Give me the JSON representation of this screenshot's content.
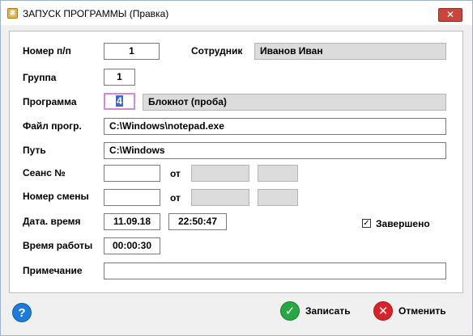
{
  "window": {
    "title": "ЗАПУСК ПРОГРАММЫ (Правка)",
    "icon": "app-icon",
    "close_label": "✕"
  },
  "form": {
    "labels": {
      "number": "Номер п/п",
      "employee": "Сотрудник",
      "group": "Группа",
      "program": "Программа",
      "program_file": "Файл прогр.",
      "path": "Путь",
      "session": "Сеанс №",
      "shift": "Номер смены",
      "datetime": "Дата. время",
      "work_time": "Время работы",
      "note": "Примечание",
      "from1": "от",
      "from2": "от"
    },
    "values": {
      "number": "1",
      "employee": "Иванов Иван",
      "group": "1",
      "program_id": "4",
      "program_name": "Блокнот (проба)",
      "program_file": "C:\\Windows\\notepad.exe",
      "path": "C:\\Windows",
      "session": "",
      "session_from_a": "",
      "session_from_b": "",
      "shift": "",
      "shift_from_a": "",
      "shift_from_b": "",
      "date": "11.09.18",
      "time": "22:50:47",
      "work_time": "00:00:30",
      "note": ""
    },
    "completed": {
      "label": "Завершено",
      "checked": true,
      "mark": "✓"
    }
  },
  "buttons": {
    "help": "?",
    "save": "Записать",
    "cancel": "Отменить"
  },
  "colors": {
    "save_icon": "#27a844",
    "cancel_icon": "#d8232a",
    "help_icon": "#1e7bd8"
  }
}
